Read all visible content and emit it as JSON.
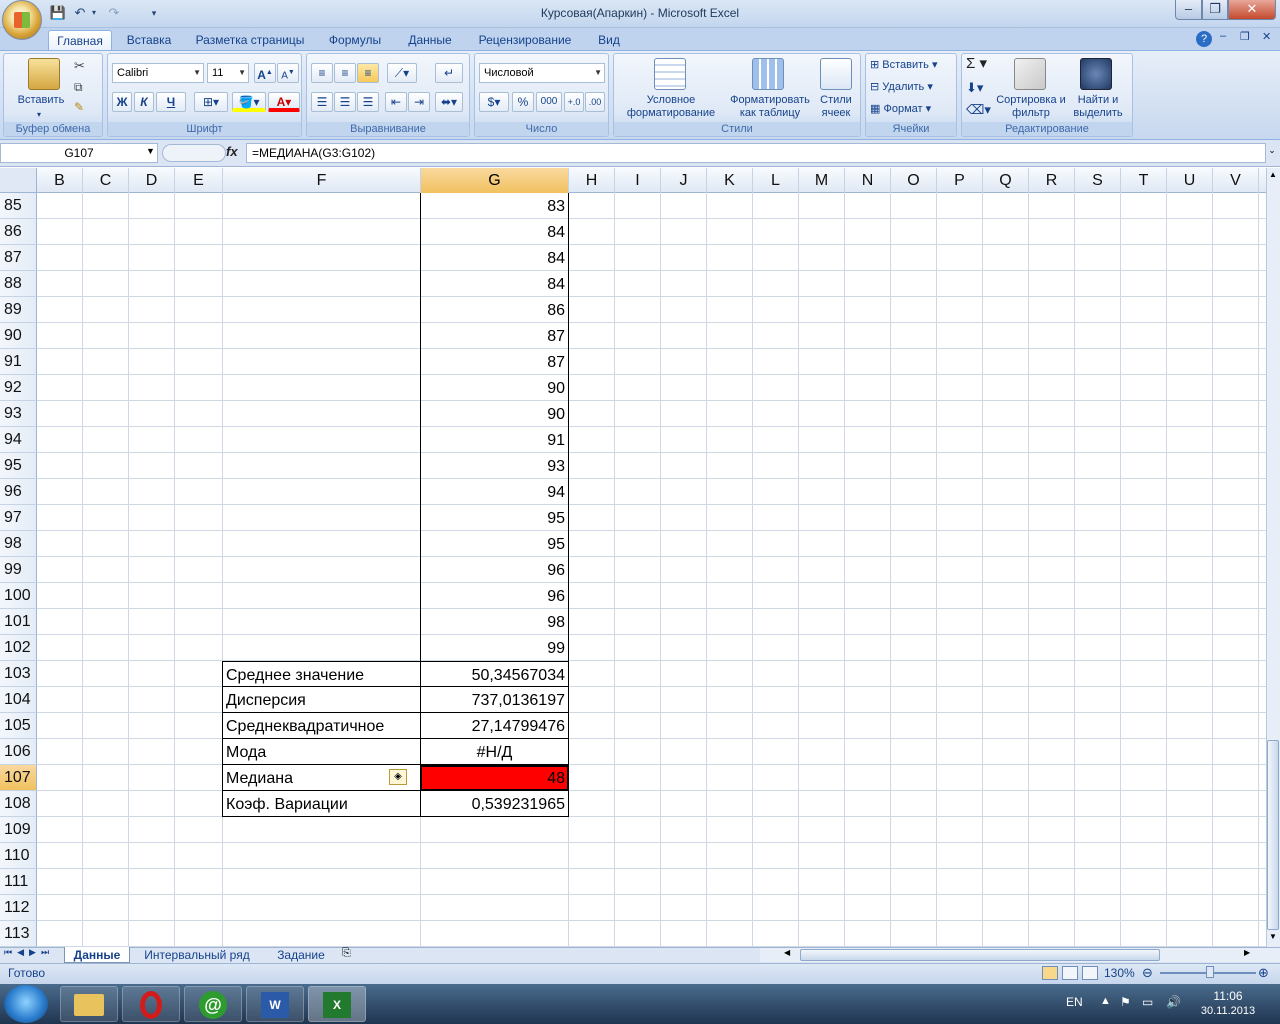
{
  "window": {
    "title": "Курсовая(Апаркин) - Microsoft Excel"
  },
  "ribbon": {
    "tabs": [
      "Главная",
      "Вставка",
      "Разметка страницы",
      "Формулы",
      "Данные",
      "Рецензирование",
      "Вид"
    ],
    "clipboard": {
      "paste": "Вставить",
      "label": "Буфер обмена"
    },
    "font": {
      "name": "Calibri",
      "size": "11",
      "label": "Шрифт",
      "bold": "Ж",
      "italic": "К",
      "underline": "Ч"
    },
    "alignment": {
      "label": "Выравнивание"
    },
    "number": {
      "format": "Числовой",
      "label": "Число",
      "percent": "%",
      "thousands": "000"
    },
    "styles": {
      "conditional": "Условное форматирование",
      "as_table": "Форматировать как таблицу",
      "cell_styles": "Стили ячеек",
      "label": "Стили"
    },
    "cells": {
      "insert": "Вставить",
      "delete": "Удалить",
      "format": "Формат",
      "label": "Ячейки"
    },
    "editing": {
      "sort": "Сортировка и фильтр",
      "find": "Найти и выделить",
      "label": "Редактирование"
    }
  },
  "formula_bar": {
    "name_box": "G107",
    "fx": "fx",
    "formula": "=МЕДИАНА(G3:G102)"
  },
  "columns": [
    "B",
    "C",
    "D",
    "E",
    "F",
    "G",
    "H",
    "I",
    "J",
    "K",
    "L",
    "M",
    "N",
    "O",
    "P",
    "Q",
    "R",
    "S",
    "T",
    "U",
    "V"
  ],
  "rows": [
    "85",
    "86",
    "87",
    "88",
    "89",
    "90",
    "91",
    "92",
    "93",
    "94",
    "95",
    "96",
    "97",
    "98",
    "99",
    "100",
    "101",
    "102",
    "103",
    "104",
    "105",
    "106",
    "107",
    "108",
    "109",
    "110",
    "111",
    "112",
    "113"
  ],
  "g_values": [
    "83",
    "84",
    "84",
    "84",
    "86",
    "87",
    "87",
    "90",
    "90",
    "91",
    "93",
    "94",
    "95",
    "95",
    "96",
    "96",
    "98",
    "99"
  ],
  "stats": [
    {
      "label": "Среднее значение",
      "value": "50,34567034"
    },
    {
      "label": "Дисперсия",
      "value": "737,0136197"
    },
    {
      "label": "Среднеквадратичное",
      "value": "27,14799476"
    },
    {
      "label": "Мода",
      "value": "#Н/Д"
    },
    {
      "label": "Медиана",
      "value": "48"
    },
    {
      "label": "Коэф. Вариации",
      "value": "0,539231965"
    }
  ],
  "sheets": [
    "Данные",
    "Интервальный ряд",
    "Задание"
  ],
  "status": {
    "ready": "Готово",
    "zoom": "130%"
  },
  "taskbar": {
    "lang": "EN",
    "time": "11:06",
    "date": "30.11.2013"
  },
  "colors": {
    "highlight_cell": "#ff0000",
    "selected_header": "#f4c96b"
  }
}
